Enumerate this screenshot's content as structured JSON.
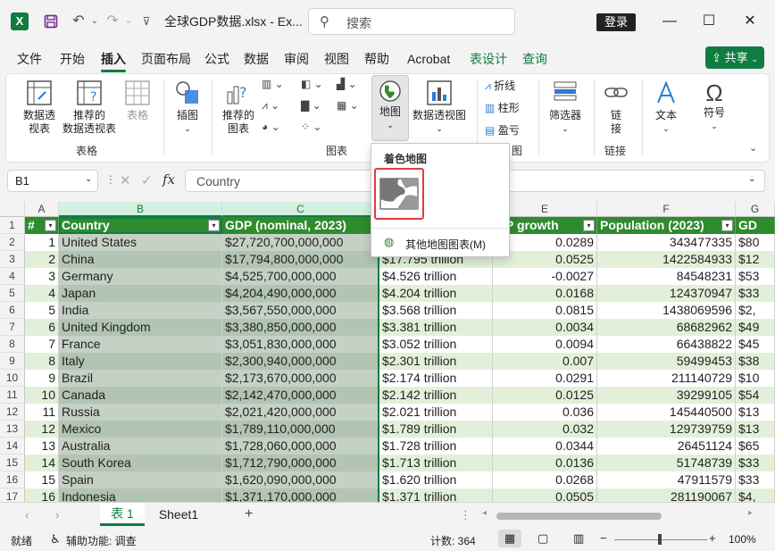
{
  "titlebar": {
    "file_title": "全球GDP数据.xlsx  -  Ex...",
    "search_placeholder": "搜索",
    "login": "登录",
    "excel_letter": "X"
  },
  "ribbon_tabs": [
    {
      "label": "文件"
    },
    {
      "label": "开始"
    },
    {
      "label": "插入"
    },
    {
      "label": "页面布局"
    },
    {
      "label": "公式"
    },
    {
      "label": "数据"
    },
    {
      "label": "审阅"
    },
    {
      "label": "视图"
    },
    {
      "label": "帮助"
    },
    {
      "label": "Acrobat"
    },
    {
      "label": "表设计"
    },
    {
      "label": "查询"
    }
  ],
  "share_label": "共享",
  "ribbon": {
    "pivot_line1": "数据透",
    "pivot_line2": "视表",
    "rec_pivot_line1": "推荐的",
    "rec_pivot_line2": "数据透视表",
    "table_label": "表格",
    "illustrations_label": "插图",
    "rec_chart_line1": "推荐的",
    "rec_chart_line2": "图表",
    "map_label": "地图",
    "pivot_chart_label": "数据透视图",
    "sparkline_line": "折线",
    "sparkline_column": "柱形",
    "sparkline_winloss": "盈亏",
    "slicer_label": "筛选器",
    "link_line1": "链",
    "link_line2": "接",
    "text_label": "文本",
    "symbol_label": "符号",
    "group_tables": "表格",
    "group_charts": "图表",
    "group_sparklines_partial": "图",
    "group_links": "链接"
  },
  "formula_bar": {
    "name_box": "B1",
    "fx": "fx",
    "content": "Country"
  },
  "map_menu": {
    "header": "着色地图",
    "more_label": "其他地图图表(M)"
  },
  "columns": [
    "A",
    "B",
    "C",
    "D",
    "E",
    "F",
    "G"
  ],
  "table_headers": {
    "idx": "#",
    "country": "Country",
    "gdp": "GDP (nominal, 2023)",
    "growth": "GDP  growth",
    "population": "Population (2023)",
    "gdp_pc_partial": "GD"
  },
  "rows": [
    {
      "r": "2",
      "idx": "1",
      "country": "United States",
      "gdp": "$27,720,700,000,000",
      "gdp_t": "",
      "growth": "0.0289",
      "pop": "343477335",
      "pc": "$80"
    },
    {
      "r": "3",
      "idx": "2",
      "country": "China",
      "gdp": "$17,794,800,000,000",
      "gdp_t": "$17.795 trillion",
      "growth": "0.0525",
      "pop": "1422584933",
      "pc": "$12"
    },
    {
      "r": "4",
      "idx": "3",
      "country": "Germany",
      "gdp": "$4,525,700,000,000",
      "gdp_t": "$4.526 trillion",
      "growth": "-0.0027",
      "pop": "84548231",
      "pc": "$53"
    },
    {
      "r": "5",
      "idx": "4",
      "country": "Japan",
      "gdp": "$4,204,490,000,000",
      "gdp_t": "$4.204 trillion",
      "growth": "0.0168",
      "pop": "124370947",
      "pc": "$33"
    },
    {
      "r": "6",
      "idx": "5",
      "country": "India",
      "gdp": "$3,567,550,000,000",
      "gdp_t": "$3.568 trillion",
      "growth": "0.0815",
      "pop": "1438069596",
      "pc": "$2,"
    },
    {
      "r": "7",
      "idx": "6",
      "country": "United Kingdom",
      "gdp": "$3,380,850,000,000",
      "gdp_t": "$3.381 trillion",
      "growth": "0.0034",
      "pop": "68682962",
      "pc": "$49"
    },
    {
      "r": "8",
      "idx": "7",
      "country": "France",
      "gdp": "$3,051,830,000,000",
      "gdp_t": "$3.052 trillion",
      "growth": "0.0094",
      "pop": "66438822",
      "pc": "$45"
    },
    {
      "r": "9",
      "idx": "8",
      "country": "Italy",
      "gdp": "$2,300,940,000,000",
      "gdp_t": "$2.301 trillion",
      "growth": "0.007",
      "pop": "59499453",
      "pc": "$38"
    },
    {
      "r": "10",
      "idx": "9",
      "country": "Brazil",
      "gdp": "$2,173,670,000,000",
      "gdp_t": "$2.174 trillion",
      "growth": "0.0291",
      "pop": "211140729",
      "pc": "$10"
    },
    {
      "r": "11",
      "idx": "10",
      "country": "Canada",
      "gdp": "$2,142,470,000,000",
      "gdp_t": "$2.142 trillion",
      "growth": "0.0125",
      "pop": "39299105",
      "pc": "$54"
    },
    {
      "r": "12",
      "idx": "11",
      "country": "Russia",
      "gdp": "$2,021,420,000,000",
      "gdp_t": "$2.021 trillion",
      "growth": "0.036",
      "pop": "145440500",
      "pc": "$13"
    },
    {
      "r": "13",
      "idx": "12",
      "country": "Mexico",
      "gdp": "$1,789,110,000,000",
      "gdp_t": "$1.789 trillion",
      "growth": "0.032",
      "pop": "129739759",
      "pc": "$13"
    },
    {
      "r": "14",
      "idx": "13",
      "country": "Australia",
      "gdp": "$1,728,060,000,000",
      "gdp_t": "$1.728 trillion",
      "growth": "0.0344",
      "pop": "26451124",
      "pc": "$65"
    },
    {
      "r": "15",
      "idx": "14",
      "country": "South Korea",
      "gdp": "$1,712,790,000,000",
      "gdp_t": "$1.713 trillion",
      "growth": "0.0136",
      "pop": "51748739",
      "pc": "$33"
    },
    {
      "r": "16",
      "idx": "15",
      "country": "Spain",
      "gdp": "$1,620,090,000,000",
      "gdp_t": "$1.620 trillion",
      "growth": "0.0268",
      "pop": "47911579",
      "pc": "$33"
    },
    {
      "r": "17",
      "idx": "16",
      "country": "Indonesia",
      "gdp": "$1,371,170,000,000",
      "gdp_t": "$1.371 trillion",
      "growth": "0.0505",
      "pop": "281190067",
      "pc": "$4,"
    }
  ],
  "row1_label": "1",
  "sheet_tabs": [
    "表 1",
    "Sheet1"
  ],
  "add_sheet": "+",
  "status": {
    "ready": "就绪",
    "accessibility": "辅助功能: 调查",
    "count": "计数: 364",
    "zoom_minus": "−",
    "zoom_plus": "+",
    "zoom": "100%"
  },
  "colors": {
    "accent": "#107c41",
    "table_header": "#2e8b2e",
    "band_light": "#e2f0d9",
    "selected_col": "#b7c9b7",
    "highlight_red": "#e03c3c"
  }
}
